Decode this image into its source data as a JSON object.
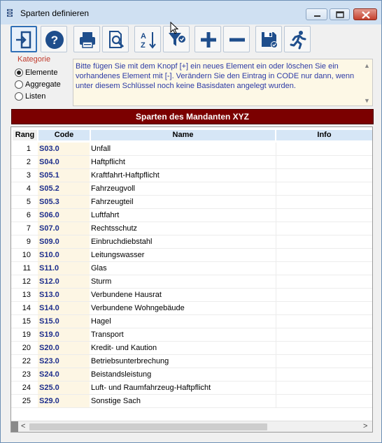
{
  "window": {
    "title": "Sparten definieren",
    "icon": "database-icon",
    "controls": [
      "minimize",
      "maximize",
      "close"
    ]
  },
  "toolbar": {
    "buttons": [
      {
        "name": "exit",
        "icon": "exit-door-icon"
      },
      {
        "name": "help",
        "icon": "question-icon"
      },
      {
        "name": "print",
        "icon": "printer-icon"
      },
      {
        "name": "preview",
        "icon": "print-preview-icon"
      },
      {
        "name": "sort",
        "icon": "sort-az-icon"
      },
      {
        "name": "filter",
        "icon": "filter-icon"
      },
      {
        "name": "add",
        "icon": "plus-icon"
      },
      {
        "name": "remove",
        "icon": "minus-icon"
      },
      {
        "name": "save",
        "icon": "save-icon"
      },
      {
        "name": "run",
        "icon": "runner-icon"
      }
    ]
  },
  "kategorie": {
    "title": "Kategorie",
    "options": [
      {
        "label": "Elemente",
        "checked": true
      },
      {
        "label": "Aggregate",
        "checked": false
      },
      {
        "label": "Listen",
        "checked": false
      }
    ]
  },
  "hint": {
    "text": "Bitte fügen Sie mit dem Knopf [+] ein neues Element ein oder löschen Sie ein vorhandenes Element mit [-]. Verändern Sie den Eintrag in CODE nur dann, wenn unter diesem Schlüssel noch keine Basisdaten angelegt wurden."
  },
  "banner": {
    "title": "Sparten des Mandanten XYZ"
  },
  "table": {
    "headers": {
      "rang": "Rang",
      "code": "Code",
      "name": "Name",
      "info": "Info"
    },
    "rows": [
      {
        "rang": "1",
        "code": "S03.0",
        "name": "Unfall",
        "info": ""
      },
      {
        "rang": "2",
        "code": "S04.0",
        "name": "Haftpflicht",
        "info": ""
      },
      {
        "rang": "3",
        "code": "S05.1",
        "name": "Kraftfahrt-Haftpflicht",
        "info": ""
      },
      {
        "rang": "4",
        "code": "S05.2",
        "name": "Fahrzeugvoll",
        "info": ""
      },
      {
        "rang": "5",
        "code": "S05.3",
        "name": "Fahrzeugteil",
        "info": ""
      },
      {
        "rang": "6",
        "code": "S06.0",
        "name": "Luftfahrt",
        "info": ""
      },
      {
        "rang": "7",
        "code": "S07.0",
        "name": "Rechtsschutz",
        "info": ""
      },
      {
        "rang": "9",
        "code": "S09.0",
        "name": "Einbruchdiebstahl",
        "info": ""
      },
      {
        "rang": "10",
        "code": "S10.0",
        "name": "Leitungswasser",
        "info": ""
      },
      {
        "rang": "11",
        "code": "S11.0",
        "name": "Glas",
        "info": ""
      },
      {
        "rang": "12",
        "code": "S12.0",
        "name": "Sturm",
        "info": ""
      },
      {
        "rang": "13",
        "code": "S13.0",
        "name": "Verbundene Hausrat",
        "info": ""
      },
      {
        "rang": "14",
        "code": "S14.0",
        "name": "Verbundene Wohngebäude",
        "info": ""
      },
      {
        "rang": "15",
        "code": "S15.0",
        "name": "Hagel",
        "info": ""
      },
      {
        "rang": "19",
        "code": "S19.0",
        "name": "Transport",
        "info": ""
      },
      {
        "rang": "20",
        "code": "S20.0",
        "name": "Kredit- und Kaution",
        "info": ""
      },
      {
        "rang": "22",
        "code": "S23.0",
        "name": "Betriebsunterbrechung",
        "info": ""
      },
      {
        "rang": "23",
        "code": "S24.0",
        "name": "Beistandsleistung",
        "info": ""
      },
      {
        "rang": "24",
        "code": "S25.0",
        "name": "Luft- und Raumfahrzeug-Haftpflicht",
        "info": ""
      },
      {
        "rang": "25",
        "code": "S29.0",
        "name": "Sonstige Sach",
        "info": ""
      }
    ]
  },
  "scrollbar": {
    "left_arrow": "<",
    "right_arrow": ">"
  },
  "colors": {
    "banner_bg": "#7b0000",
    "code_text": "#1c2d8c",
    "hint_text": "#2c3aa5",
    "kategorie_title": "#c0392b"
  }
}
